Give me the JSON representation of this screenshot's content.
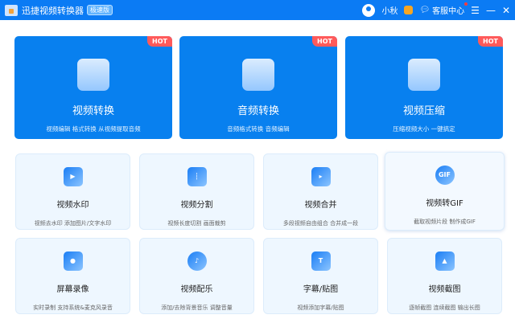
{
  "header": {
    "title": "迅捷视频转换器",
    "edition": "极速版",
    "username": "小秋",
    "service": "客服中心",
    "menu": "☰",
    "minimize": "—",
    "close": "✕"
  },
  "featured": [
    {
      "title": "视频转换",
      "desc": "视频编辑 格式转换 从视频提取音频",
      "badge": "HOT"
    },
    {
      "title": "音频转换",
      "desc": "音频格式转换 音频编辑",
      "badge": "HOT"
    },
    {
      "title": "视频压缩",
      "desc": "压缩视频大小 一键搞定",
      "badge": "HOT"
    }
  ],
  "tools": [
    {
      "title": "视频水印",
      "desc": "视频去水印 添加图片/文字水印",
      "icon": "▶"
    },
    {
      "title": "视频分割",
      "desc": "视频长度切割 画面裁剪",
      "icon": "┆"
    },
    {
      "title": "视频合并",
      "desc": "多段视频自由组合 合并成一段",
      "icon": "▸"
    },
    {
      "title": "视频转GIF",
      "desc": "截取视频片段 制作成GIF",
      "icon": "GIF"
    },
    {
      "title": "屏幕录像",
      "desc": "实时录制 支持系统&麦克风录音",
      "icon": "●"
    },
    {
      "title": "视频配乐",
      "desc": "添加/去除背景音乐 调整音量",
      "icon": "♪"
    },
    {
      "title": "字幕/贴图",
      "desc": "视频添加字幕/贴图",
      "icon": "T"
    },
    {
      "title": "视频截图",
      "desc": "逐帧截图 连续截图 输出长图",
      "icon": "▲"
    }
  ]
}
